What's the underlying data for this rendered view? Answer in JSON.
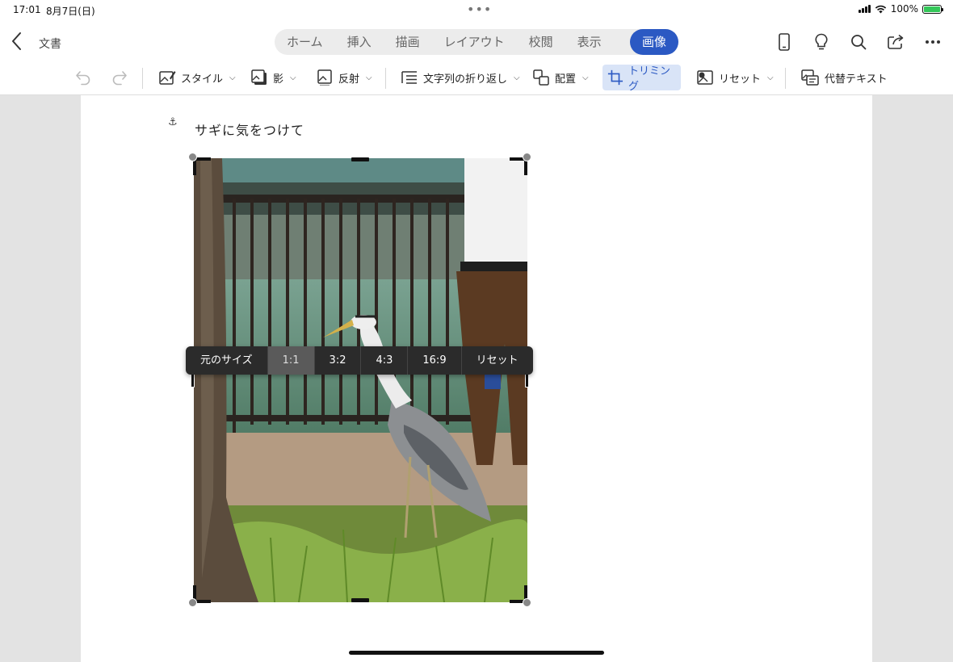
{
  "status": {
    "time": "17:01",
    "date": "8月7日(日)",
    "battery_pct": "100%"
  },
  "header": {
    "doc_name": "文書",
    "tabs": [
      {
        "label": "ホーム"
      },
      {
        "label": "挿入"
      },
      {
        "label": "描画"
      },
      {
        "label": "レイアウト"
      },
      {
        "label": "校閲"
      },
      {
        "label": "表示"
      },
      {
        "label": "画像"
      }
    ],
    "active_tab": "画像"
  },
  "toolbar": {
    "style": "スタイル",
    "shadow": "影",
    "reflection": "反射",
    "wrap_text": "文字列の折り返し",
    "arrange": "配置",
    "crop": "トリミング",
    "reset": "リセット",
    "alt_text": "代替テキスト"
  },
  "document": {
    "text": "サギに気をつけて"
  },
  "crop_menu": {
    "options": [
      "元のサイズ",
      "1:1",
      "3:2",
      "4:3",
      "16:9",
      "リセット"
    ],
    "selected": "1:1"
  },
  "colors": {
    "accent": "#2b59c3",
    "crop_selected_bg": "#d9e4f7",
    "menu_bg": "#2b2b2b"
  },
  "icons": [
    "back-icon",
    "phone-icon",
    "lightbulb-icon",
    "search-icon",
    "share-icon",
    "more-icon",
    "undo-icon",
    "redo-icon",
    "style-icon",
    "shadow-icon",
    "reflection-icon",
    "wrap-text-icon",
    "arrange-icon",
    "crop-icon",
    "reset-picture-icon",
    "alt-text-icon",
    "anchor-icon"
  ]
}
